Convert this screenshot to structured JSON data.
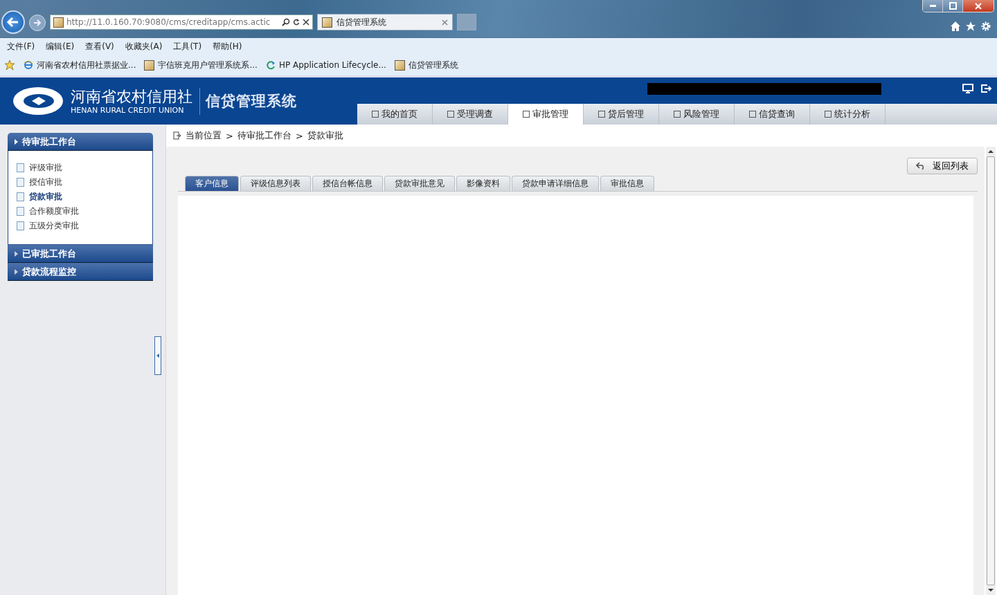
{
  "browser": {
    "address": "http://11.0.160.70:9080/cms/creditapp/cms.actic",
    "tab_title": "信贷管理系统",
    "menu": [
      "文件(F)",
      "编辑(E)",
      "查看(V)",
      "收藏夹(A)",
      "工具(T)",
      "帮助(H)"
    ],
    "favorites": [
      {
        "label": "河南省农村信用社票据业...",
        "kind": "ie"
      },
      {
        "label": "宇信班克用户管理系统系...",
        "kind": "page"
      },
      {
        "label": "HP Application Lifecycle...",
        "kind": "refresh"
      },
      {
        "label": "信贷管理系统",
        "kind": "page"
      }
    ]
  },
  "header": {
    "org_name": "河南省农村信用社",
    "org_name_en": "HENAN RURAL CREDIT UNION",
    "system_name": "信贷管理系统"
  },
  "nav": [
    {
      "label": "我的首页",
      "selected": false
    },
    {
      "label": "受理调查",
      "selected": false
    },
    {
      "label": "审批管理",
      "selected": true
    },
    {
      "label": "贷后管理",
      "selected": false
    },
    {
      "label": "风险管理",
      "selected": false
    },
    {
      "label": "信贷查询",
      "selected": false
    },
    {
      "label": "统计分析",
      "selected": false
    }
  ],
  "sidebar": [
    {
      "title": "待审批工作台",
      "expanded": true,
      "items": [
        {
          "label": "评级审批",
          "selected": false
        },
        {
          "label": "授信审批",
          "selected": false
        },
        {
          "label": "贷款审批",
          "selected": true
        },
        {
          "label": "合作额度审批",
          "selected": false
        },
        {
          "label": "五级分类审批",
          "selected": false
        }
      ]
    },
    {
      "title": "已审批工作台",
      "expanded": false
    },
    {
      "title": "贷款流程监控",
      "expanded": false
    }
  ],
  "breadcrumb": [
    "当前位置",
    "待审批工作台",
    "贷款审批"
  ],
  "breadcrumb_separator": ">",
  "back_button": "返回列表",
  "tabs": [
    {
      "label": "客户信息",
      "selected": true
    },
    {
      "label": "评级信息列表",
      "selected": false
    },
    {
      "label": "授信台帐信息",
      "selected": false
    },
    {
      "label": "贷款审批意见",
      "selected": false
    },
    {
      "label": "影像资料",
      "selected": false
    },
    {
      "label": "贷款申请详细信息",
      "selected": false
    },
    {
      "label": "审批信息",
      "selected": false
    }
  ]
}
